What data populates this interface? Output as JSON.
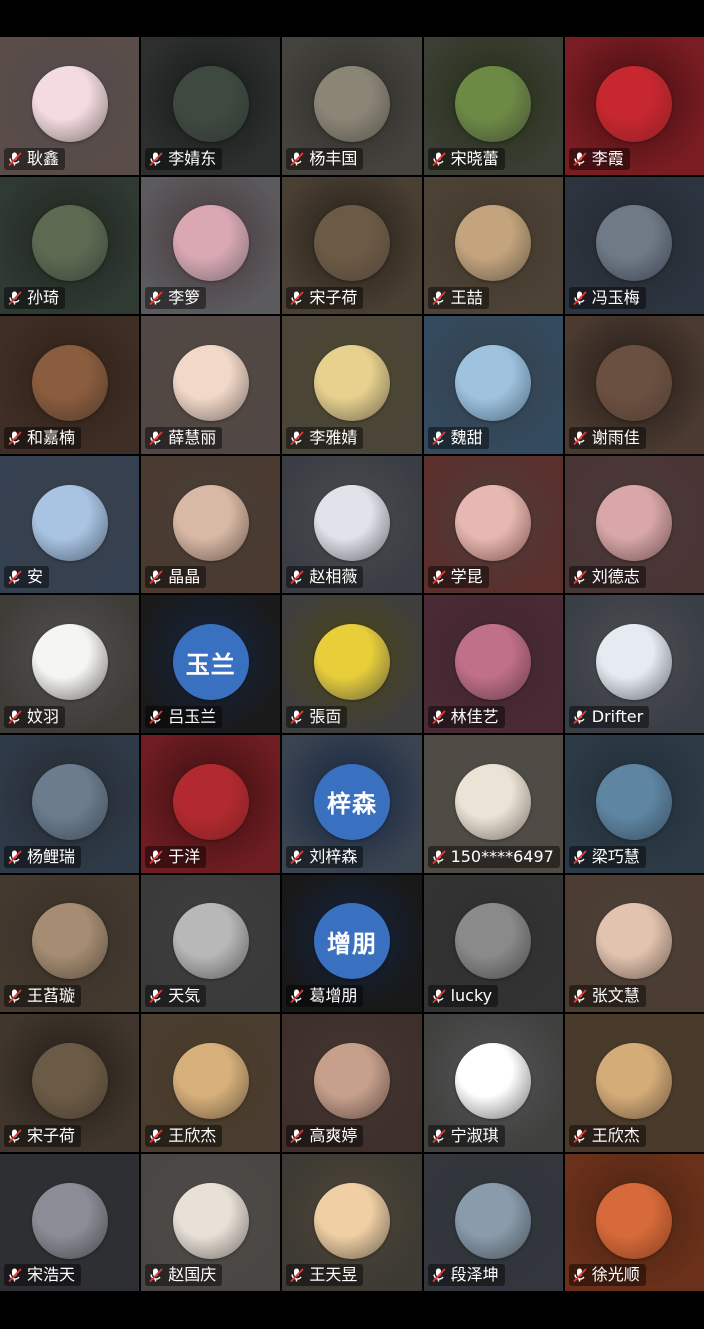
{
  "meeting": {
    "participants": [
      {
        "name": "耿鑫",
        "avatar_type": "cartoon-pig",
        "bg": "#5a4d49",
        "av": "#f3dbe0"
      },
      {
        "name": "李婧东",
        "avatar_type": "waterfall-photo",
        "bg": "#2d302f",
        "av": "#3e4a40"
      },
      {
        "name": "杨丰国",
        "avatar_type": "seaside-photo",
        "bg": "#45433d",
        "av": "#8b8576"
      },
      {
        "name": "宋晓蕾",
        "avatar_type": "green-field-photo",
        "bg": "#3b3e33",
        "av": "#6d8a45"
      },
      {
        "name": "李霞",
        "avatar_type": "red-flower-photo",
        "bg": "#7a1d22",
        "av": "#c7272f"
      },
      {
        "name": "孙琦",
        "avatar_type": "person-photo",
        "bg": "#2f3a33",
        "av": "#5c6a52"
      },
      {
        "name": "李箩",
        "avatar_type": "person-photo",
        "bg": "#5b5a5d",
        "av": "#d9a8b3"
      },
      {
        "name": "宋子荷",
        "avatar_type": "cat-photo",
        "bg": "#4a3f33",
        "av": "#6b5a45"
      },
      {
        "name": "王喆",
        "avatar_type": "teddy-bear-photo",
        "bg": "#4c4236",
        "av": "#c3a47d"
      },
      {
        "name": "冯玉梅",
        "avatar_type": "flowers-photo",
        "bg": "#2c3440",
        "av": "#6f7a86"
      },
      {
        "name": "和嘉楠",
        "avatar_type": "person-photo",
        "bg": "#3f2e25",
        "av": "#8a5d3e"
      },
      {
        "name": "薛慧丽",
        "avatar_type": "cartoon-pig",
        "bg": "#514845",
        "av": "#f1d8c8"
      },
      {
        "name": "李雅婧",
        "avatar_type": "cartoon-character",
        "bg": "#4a4538",
        "av": "#e7d18f"
      },
      {
        "name": "魏甜",
        "avatar_type": "beach-photo",
        "bg": "#344a5e",
        "av": "#9fc3df"
      },
      {
        "name": "谢雨佳",
        "avatar_type": "person-photo",
        "bg": "#4a3a30",
        "av": "#6a5040"
      },
      {
        "name": "安",
        "avatar_type": "airplane-photo",
        "bg": "#354050",
        "av": "#a9c4e3"
      },
      {
        "name": "晶晶",
        "avatar_type": "child-photo",
        "bg": "#4a3a30",
        "av": "#d8b9a6"
      },
      {
        "name": "赵相薇",
        "avatar_type": "child-photo",
        "bg": "#3a3d44",
        "av": "#e1e3ea"
      },
      {
        "name": "学昆",
        "avatar_type": "person-photo",
        "bg": "#5a2f2c",
        "av": "#e6b8b1"
      },
      {
        "name": "刘德志",
        "avatar_type": "pink-sky-photo",
        "bg": "#4a3535",
        "av": "#d9a7a7"
      },
      {
        "name": "妏羽",
        "avatar_type": "calligraphy",
        "bg": "#3f3c38",
        "av": "#f5f5f3"
      },
      {
        "name": "吕玉兰",
        "avatar_type": "text",
        "avatar_text": "玉兰",
        "bg": "#1a1a1a",
        "av": "#3a70c0"
      },
      {
        "name": "張靣",
        "avatar_type": "minion-cartoon",
        "bg": "#3e3e3e",
        "av": "#e8cf3a"
      },
      {
        "name": "林佳艺",
        "avatar_type": "person-photo",
        "bg": "#4a2a35",
        "av": "#c07088"
      },
      {
        "name": "Drifter",
        "avatar_type": "moon-photo",
        "bg": "#3a3e46",
        "av": "#e6ebf2"
      },
      {
        "name": "杨鲤瑞",
        "avatar_type": "person-photo",
        "bg": "#2f3a48",
        "av": "#6c7c8c"
      },
      {
        "name": "于洋",
        "avatar_type": "person-photo",
        "bg": "#6e1d22",
        "av": "#b22a2f"
      },
      {
        "name": "刘梓森",
        "avatar_type": "text",
        "avatar_text": "梓森",
        "bg": "#3a4350",
        "av": "#3a70c0"
      },
      {
        "name": "150****6497",
        "avatar_type": "cartoon-character",
        "bg": "#4f4a43",
        "av": "#ece3d7"
      },
      {
        "name": "梁巧慧",
        "avatar_type": "lake-photo",
        "bg": "#2d3b47",
        "av": "#5e86a3"
      },
      {
        "name": "王萏璇",
        "avatar_type": "shadow-photo",
        "bg": "#43392f",
        "av": "#a58c72"
      },
      {
        "name": "天気",
        "avatar_type": "tree-photo",
        "bg": "#3a3a3a",
        "av": "#b8b8b8"
      },
      {
        "name": "葛增朋",
        "avatar_type": "text",
        "avatar_text": "增朋",
        "bg": "#181818",
        "av": "#3a70c0"
      },
      {
        "name": "lucky",
        "avatar_type": "bw-person-photo",
        "bg": "#333333",
        "av": "#8a8a8a"
      },
      {
        "name": "张文慧",
        "avatar_type": "child-photo",
        "bg": "#4b3b30",
        "av": "#e2c3b0"
      },
      {
        "name": "宋子荷",
        "avatar_type": "cat-photo",
        "bg": "#40362d",
        "av": "#6b5a45"
      },
      {
        "name": "王欣杰",
        "avatar_type": "dog-photo",
        "bg": "#4a3d2f",
        "av": "#d7b07b"
      },
      {
        "name": "高爽婷",
        "avatar_type": "person-photo",
        "bg": "#3f2f2b",
        "av": "#c7a08c"
      },
      {
        "name": "宁淑琪",
        "avatar_type": "line-drawing",
        "bg": "#40403f",
        "av": "#ffffff"
      },
      {
        "name": "王欣杰",
        "avatar_type": "dog-photo",
        "bg": "#4a3a2c",
        "av": "#d4ac78"
      },
      {
        "name": "宋浩天",
        "avatar_type": "person-photo",
        "bg": "#2e2f33",
        "av": "#8c8c96"
      },
      {
        "name": "赵国庆",
        "avatar_type": "face-drawing",
        "bg": "#4a4643",
        "av": "#e8e1d8"
      },
      {
        "name": "王天昱",
        "avatar_type": "cartoon-character",
        "bg": "#3c3a33",
        "av": "#f0cfa4"
      },
      {
        "name": "段泽坤",
        "avatar_type": "seaside-photo",
        "bg": "#33373d",
        "av": "#8a9bab"
      },
      {
        "name": "徐光顺",
        "avatar_type": "person-photo",
        "bg": "#6b3019",
        "av": "#d66a3a"
      }
    ]
  }
}
